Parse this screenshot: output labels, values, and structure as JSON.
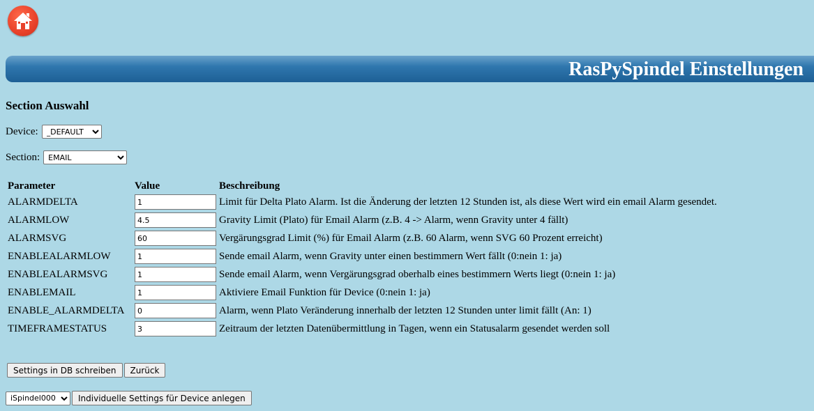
{
  "header": {
    "title": "RasPySpindel Einstellungen",
    "home_icon": "home-icon",
    "home_color": "#e8412a",
    "banner_color": "#2f77ae"
  },
  "section_select": {
    "heading": "Section Auswahl",
    "device_label": "Device:",
    "device_value": "_DEFAULT",
    "section_label": "Section:",
    "section_value": "EMAIL"
  },
  "table": {
    "headers": {
      "parameter": "Parameter",
      "value": "Value",
      "description": "Beschreibung"
    },
    "rows": [
      {
        "parameter": "ALARMDELTA",
        "value": "1",
        "description": "Limit für Delta Plato Alarm. Ist die Änderung der letzten 12 Stunden ist, als diese Wert wird ein email Alarm gesendet."
      },
      {
        "parameter": "ALARMLOW",
        "value": "4.5",
        "description": "Gravity Limit (Plato) für Email Alarm (z.B. 4 -> Alarm, wenn Gravity unter 4 fällt)"
      },
      {
        "parameter": "ALARMSVG",
        "value": "60",
        "description": "Vergärungsgrad Limit (%) für Email Alarm (z.B. 60 Alarm, wenn SVG 60 Prozent erreicht)"
      },
      {
        "parameter": "ENABLEALARMLOW",
        "value": "1",
        "description": "Sende email Alarm, wenn Gravity unter einen bestimmern Wert fällt (0:nein 1: ja)"
      },
      {
        "parameter": "ENABLEALARMSVG",
        "value": "1",
        "description": "Sende email Alarm, wenn Vergärungsgrad oberhalb eines bestimmern Werts liegt (0:nein 1: ja)"
      },
      {
        "parameter": "ENABLEMAIL",
        "value": "1",
        "description": "Aktiviere Email Funktion für Device (0:nein 1: ja)"
      },
      {
        "parameter": "ENABLE_ALARMDELTA",
        "value": "0",
        "description": "Alarm, wenn Plato Veränderung innerhalb der letzten 12 Stunden unter limit fällt (An: 1)"
      },
      {
        "parameter": "TIMEFRAMESTATUS",
        "value": "3",
        "description": "Zeitraum der letzten Datenübermittlung in Tagen, wenn ein Statusalarm gesendet werden soll"
      }
    ]
  },
  "actions": {
    "save_label": "Settings in DB schreiben",
    "back_label": "Zurück",
    "device_select_value": "iSpindel000",
    "create_label": "Individuelle Settings für Device anlegen"
  }
}
